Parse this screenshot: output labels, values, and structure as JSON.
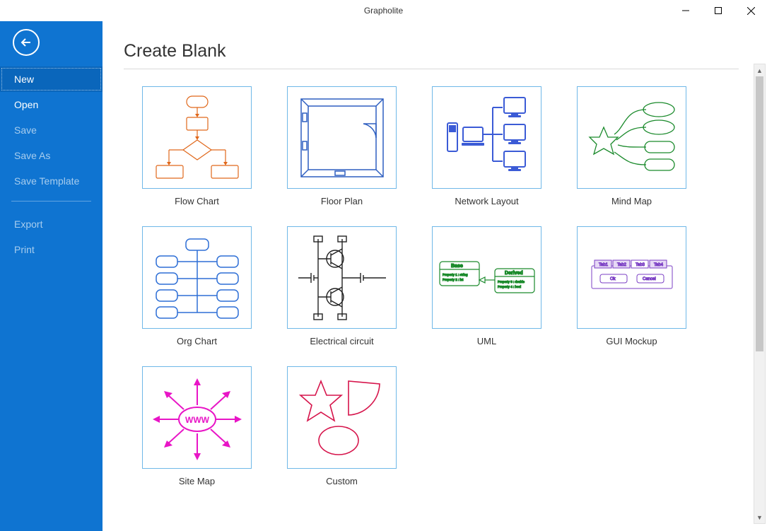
{
  "app": {
    "title": "Grapholite"
  },
  "sidebar": {
    "items": [
      {
        "label": "New",
        "state": "selected"
      },
      {
        "label": "Open",
        "state": "emph"
      },
      {
        "label": "Save",
        "state": "disabled"
      },
      {
        "label": "Save As",
        "state": "disabled"
      },
      {
        "label": "Save Template",
        "state": "disabled"
      },
      {
        "label": "Export",
        "state": "disabled"
      },
      {
        "label": "Print",
        "state": "disabled"
      }
    ]
  },
  "page": {
    "heading": "Create Blank"
  },
  "templates": [
    {
      "id": "flowchart",
      "label": "Flow Chart"
    },
    {
      "id": "floorplan",
      "label": "Floor Plan"
    },
    {
      "id": "network",
      "label": "Network Layout"
    },
    {
      "id": "mindmap",
      "label": "Mind Map"
    },
    {
      "id": "orgchart",
      "label": "Org Chart"
    },
    {
      "id": "electrical",
      "label": "Electrical circuit"
    },
    {
      "id": "uml",
      "label": "UML"
    },
    {
      "id": "gui",
      "label": "GUI Mockup"
    },
    {
      "id": "sitemap",
      "label": "Site Map"
    },
    {
      "id": "custom",
      "label": "Custom"
    }
  ],
  "gui_mockup": {
    "tabs": [
      "Tab1",
      "Tab2",
      "Tab3",
      "Tab4"
    ],
    "buttons": [
      "Ok",
      "Cancel"
    ]
  },
  "uml_text": {
    "base": "Base",
    "base_props": "Property 1 : string\nProperty 2 : int",
    "derived": "Derived",
    "derived_props": "Property 3 : double\nProperty 4 : bool"
  },
  "sitemap_center": "WWW"
}
